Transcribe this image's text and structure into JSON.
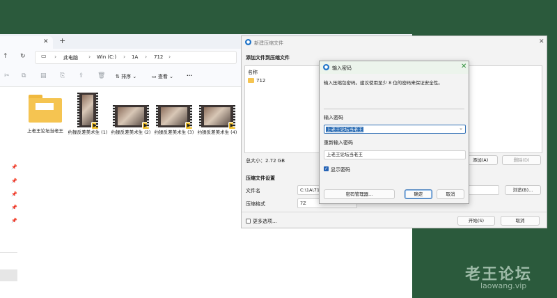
{
  "explorer": {
    "tab_close": "✕",
    "tab_new": "+",
    "nav": {
      "back": "↑",
      "refresh": "↻",
      "pc_icon": "▭"
    },
    "breadcrumb": [
      "此电脑",
      "Win (C:)",
      "1A",
      "712"
    ],
    "breadcrumb_sep": "›",
    "toolbar": {
      "sort_label": "排序",
      "view_label": "查看",
      "more": "···",
      "cut": "✂",
      "copy": "⧉",
      "paste": "▤",
      "rename": "⎘",
      "share": "⇪",
      "delete": "🗑"
    },
    "pins": [
      "📌",
      "📌",
      "📌",
      "📌",
      "📌"
    ],
    "files": [
      {
        "name": "上老王论坛当老王",
        "type": "folder"
      },
      {
        "name": "约操反差美术生 (1)",
        "type": "video"
      },
      {
        "name": "约操反差美术生 (2)",
        "type": "video"
      },
      {
        "name": "约操反差美术生 (3)",
        "type": "video"
      },
      {
        "name": "约操反差美术生 (4)",
        "type": "video"
      }
    ]
  },
  "archive": {
    "title": "新建压缩文件",
    "close": "✕",
    "section_add": "添加文件到压缩文件",
    "list_header": "名称",
    "list_item": "712",
    "total_size": "总大小：2.72 GB",
    "add_button": "添加(A)",
    "delete_button": "删除(D)",
    "section_settings": "压缩文件设置",
    "filename_label": "文件名",
    "filename_value": "C:\\1A\\712",
    "browse_button": "浏览(B)...",
    "format_label": "压缩格式",
    "format_value": "7Z",
    "more_options": "更多选项...",
    "start_button": "开始(S)",
    "cancel_button": "取消"
  },
  "password_dialog": {
    "title": "输入密码",
    "close": "✕",
    "hint": "输入压缩包密码。建议使用至少 8 位的密码来保证安全性。",
    "enter_label": "输入密码",
    "enter_value": "上老王论坛当老王",
    "reenter_label": "重新输入密码",
    "reenter_value": "上老王论坛当老王",
    "show_password": "显示密码",
    "manager_button": "密码管理器...",
    "ok_button": "确定",
    "cancel_button": "取消"
  },
  "watermark": {
    "title": "老王论坛",
    "url": "laowang.vip"
  },
  "colors": {
    "desktop": "#2b5a3c",
    "accent": "#2f6fb5",
    "badge": "#f2c230"
  }
}
